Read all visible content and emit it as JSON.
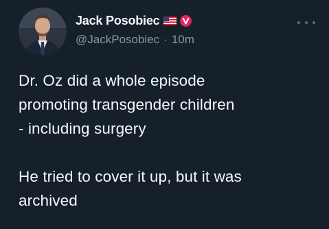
{
  "tweet": {
    "author": {
      "display_name": "Jack Posobiec",
      "handle": "@JackPosobiec",
      "badges": [
        "us-flag-icon",
        "verified-badge-icon"
      ]
    },
    "separator": "·",
    "timestamp": "10m",
    "more_icon": "more-options-icon",
    "paragraphs": [
      "Dr. Oz did a whole episode\npromoting transgender children\n- including surgery",
      "He tried to cover it up, but it was\narchived"
    ]
  },
  "colors": {
    "background": "#15202b",
    "text_primary": "#f7f9f9",
    "text_secondary": "#8b98a5",
    "verified_badge": "#e0245e"
  }
}
